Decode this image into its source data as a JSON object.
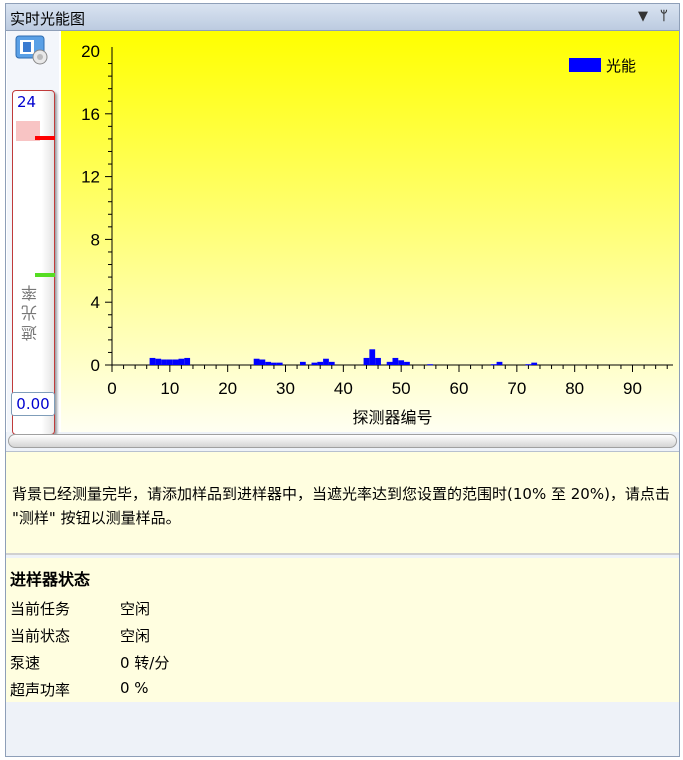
{
  "window": {
    "title": "实时光能图",
    "dropdown_glyph": "▼",
    "pin_glyph": "ᛘ"
  },
  "slider": {
    "max_label": "24",
    "min_value": "0.00",
    "label": "遮光率",
    "red_marker_value": 20,
    "green_marker_value": 10
  },
  "chart_data": {
    "type": "bar",
    "title": "",
    "xlabel": "探测器编号",
    "ylabel": "",
    "xlim": [
      0,
      97
    ],
    "ylim": [
      0,
      20
    ],
    "xticks": [
      0,
      10,
      20,
      30,
      40,
      50,
      60,
      70,
      80,
      90
    ],
    "yticks": [
      0,
      4,
      8,
      12,
      16,
      20
    ],
    "legend": {
      "label": "光能",
      "placement": "top-right"
    },
    "series": [
      {
        "name": "光能",
        "color": "#0000ff",
        "x": [
          7,
          8,
          9,
          10,
          11,
          12,
          13,
          25,
          26,
          27,
          28,
          29,
          33,
          35,
          36,
          37,
          38,
          44,
          45,
          46,
          48,
          49,
          50,
          51,
          55,
          66,
          67,
          72,
          73
        ],
        "values": [
          0.45,
          0.4,
          0.35,
          0.35,
          0.35,
          0.4,
          0.45,
          0.4,
          0.35,
          0.2,
          0.15,
          0.15,
          0.2,
          0.15,
          0.2,
          0.4,
          0.2,
          0.45,
          1.0,
          0.45,
          0.2,
          0.45,
          0.3,
          0.2,
          0.05,
          0.05,
          0.2,
          0.05,
          0.15
        ]
      }
    ]
  },
  "message": "背景已经测量完毕，请添加样品到进样器中，当遮光率达到您设置的范围时(10% 至 20%)，请点击 \"测样\" 按钮以测量样品。",
  "status": {
    "title": "进样器状态",
    "rows": [
      {
        "label": "当前任务",
        "value": "空闲"
      },
      {
        "label": "当前状态",
        "value": "空闲"
      },
      {
        "label": "泵速",
        "value": "0 转/分"
      },
      {
        "label": "超声功率",
        "value": "0 %"
      }
    ]
  }
}
